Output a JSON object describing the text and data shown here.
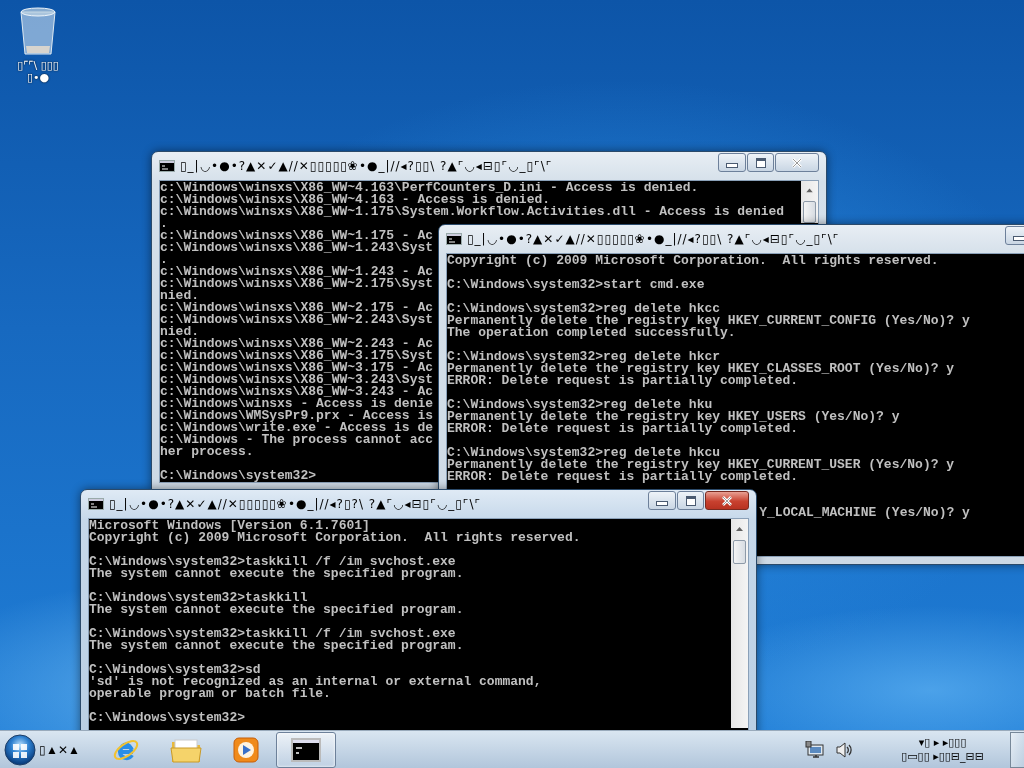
{
  "desktop_icons": [
    {
      "label_lines": [
        "▯⌜⌜\\ ▯▯▯",
        "▯•●"
      ]
    }
  ],
  "windows": [
    {
      "title": "▯_|◡•●•?▲✕✓▲//✕▯▯▯▯▯❀•●_|//◂?▯▯\\ ?▲⌜◡◂⊟▯⌜◡_▯⌜\\⌜",
      "active": false,
      "blocks": [
        {
          "kind": "text",
          "lines": [
            "c:\\Windows\\winsxs\\X86_WW~4.163\\PerfCounters_D.ini - Access is denied.",
            "c:\\Windows\\winsxs\\X86_WW~4.163 - Access is denied.",
            "c:\\Windows\\winsxs\\X86_WW~1.175\\System.Workflow.Activities.dll - Access is denied",
            ".",
            "c:\\Windows\\winsxs\\X86_WW~1.175 - Ac",
            "c:\\Windows\\winsxs\\X86_WW~1.243\\Syst",
            ".",
            "c:\\Windows\\winsxs\\X86_WW~1.243 - Ac",
            "c:\\Windows\\winsxs\\X86_WW~2.175\\Syst",
            "nied.",
            "c:\\Windows\\winsxs\\X86_WW~2.175 - Ac",
            "c:\\Windows\\winsxs\\X86_WW~2.243\\Syst",
            "nied.",
            "c:\\Windows\\winsxs\\X86_WW~2.243 - Ac",
            "c:\\Windows\\winsxs\\X86_WW~3.175\\Syst",
            "c:\\Windows\\winsxs\\X86_WW~3.175 - Ac",
            "c:\\Windows\\winsxs\\X86_WW~3.243\\Syst",
            "c:\\Windows\\winsxs\\X86_WW~3.243 - Ac",
            "c:\\Windows\\winsxs - Access is denie",
            "c:\\Windows\\WMSysPr9.prx - Access is",
            "c:\\Windows\\write.exe - Access is de",
            "c:\\Windows - The process cannot acc",
            "her process."
          ]
        },
        {
          "kind": "text",
          "lines": [
            "C:\\Windows\\system32>"
          ]
        }
      ]
    },
    {
      "title": "▯_|◡•●•?▲✕✓▲//✕▯▯▯▯▯❀•●_|//◂?▯▯\\ ?▲⌜◡◂⊟▯⌜◡_▯⌜\\⌜",
      "active": false,
      "blocks": [
        {
          "kind": "text",
          "lines": [
            "Copyright (c) 2009 Microsoft Corporation.  All rights reserved."
          ]
        },
        {
          "kind": "text",
          "lines": [
            "C:\\Windows\\system32>start cmd.exe"
          ]
        },
        {
          "kind": "text",
          "lines": [
            "C:\\Windows\\system32>reg delete hkcc",
            "Permanently delete the registry key HKEY_CURRENT_CONFIG (Yes/No)? y",
            "The operation completed successfully."
          ]
        },
        {
          "kind": "text",
          "lines": [
            "C:\\Windows\\system32>reg delete hkcr",
            "Permanently delete the registry key HKEY_CLASSES_ROOT (Yes/No)? y",
            "ERROR: Delete request is partially completed."
          ]
        },
        {
          "kind": "text",
          "lines": [
            "C:\\Windows\\system32>reg delete hku",
            "Permanently delete the registry key HKEY_USERS (Yes/No)? y",
            "ERROR: Delete request is partially completed."
          ]
        },
        {
          "kind": "text",
          "lines": [
            "C:\\Windows\\system32>reg delete hkcu",
            "Permanently delete the registry key HKEY_CURRENT_USER (Yes/No)? y",
            "ERROR: Delete request is partially completed."
          ]
        },
        {
          "kind": "covered",
          "lines": [
            "Y_LOCAL_MACHINE (Yes/No)? y"
          ]
        }
      ]
    },
    {
      "title": "▯_|◡•●•?▲✕✓▲//✕▯▯▯▯▯❀•●_|//◂?▯?\\ ?▲⌜◡◂⊟▯⌜◡_▯⌜\\⌜",
      "active": true,
      "blocks": [
        {
          "kind": "text",
          "lines": [
            "Microsoft Windows [Version 6.1.7601]",
            "Copyright (c) 2009 Microsoft Corporation.  All rights reserved."
          ]
        },
        {
          "kind": "text",
          "lines": [
            "C:\\Windows\\system32>taskkill /f /im svchost.exe",
            "The system cannot execute the specified program."
          ]
        },
        {
          "kind": "text",
          "lines": [
            "C:\\Windows\\system32>taskkill",
            "The system cannot execute the specified program."
          ]
        },
        {
          "kind": "text",
          "lines": [
            "C:\\Windows\\system32>taskkill /f /im svchost.exe",
            "The system cannot execute the specified program."
          ]
        },
        {
          "kind": "text",
          "lines": [
            "C:\\Windows\\system32>sd",
            "'sd' is not recognized as an internal or external command,",
            "operable program or batch file."
          ]
        },
        {
          "kind": "text",
          "lines": [
            "C:\\Windows\\system32>"
          ]
        }
      ]
    }
  ],
  "taskbar": {
    "start": {
      "label": "▯▲✕▲"
    },
    "items": [
      {
        "kind": "browser",
        "selected": false
      },
      {
        "kind": "folder",
        "selected": false
      },
      {
        "kind": "media",
        "selected": false
      },
      {
        "kind": "console",
        "selected": true
      }
    ],
    "clock_lines": [
      "▾▯ ▸ ▸▯▯▯",
      "▯▭▯▯ ▸▯▯⊟_⊟⊟"
    ]
  }
}
